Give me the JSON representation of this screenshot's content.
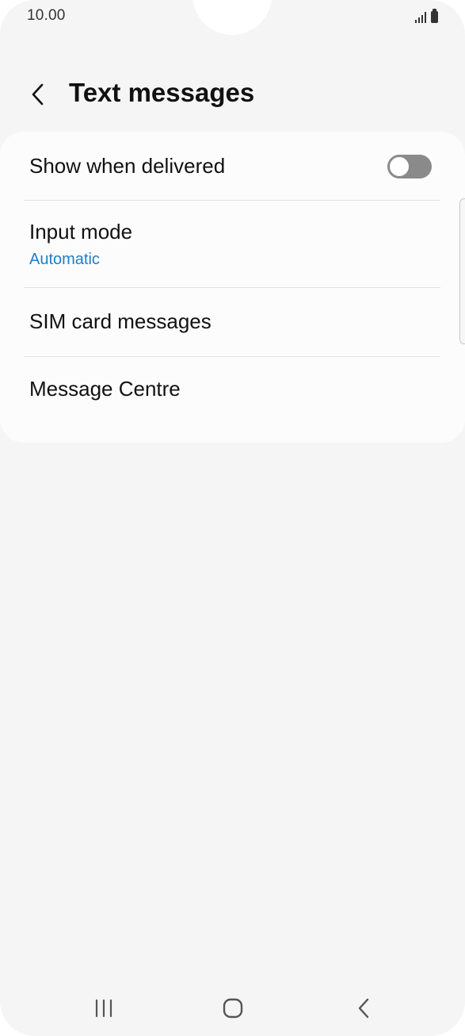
{
  "status_bar": {
    "time": "10.00",
    "signal_icon": "signal-bars-icon",
    "battery_icon": "battery-icon"
  },
  "header": {
    "back_icon": "chevron-left-icon",
    "title": "Text messages"
  },
  "settings": {
    "show_when_delivered": {
      "label": "Show when delivered",
      "toggle_on": false
    },
    "input_mode": {
      "label": "Input mode",
      "value": "Automatic"
    },
    "sim_card_messages": {
      "label": "SIM card messages"
    },
    "message_centre": {
      "label": "Message Centre"
    }
  },
  "nav_bar": {
    "recents_icon": "recents-icon",
    "home_icon": "home-icon",
    "back_icon": "back-icon"
  },
  "colors": {
    "background": "#f5f5f5",
    "card": "#fcfcfc",
    "accent": "#1e7ec5",
    "toggle_off": "#8a8a8a",
    "text": "#111111"
  }
}
